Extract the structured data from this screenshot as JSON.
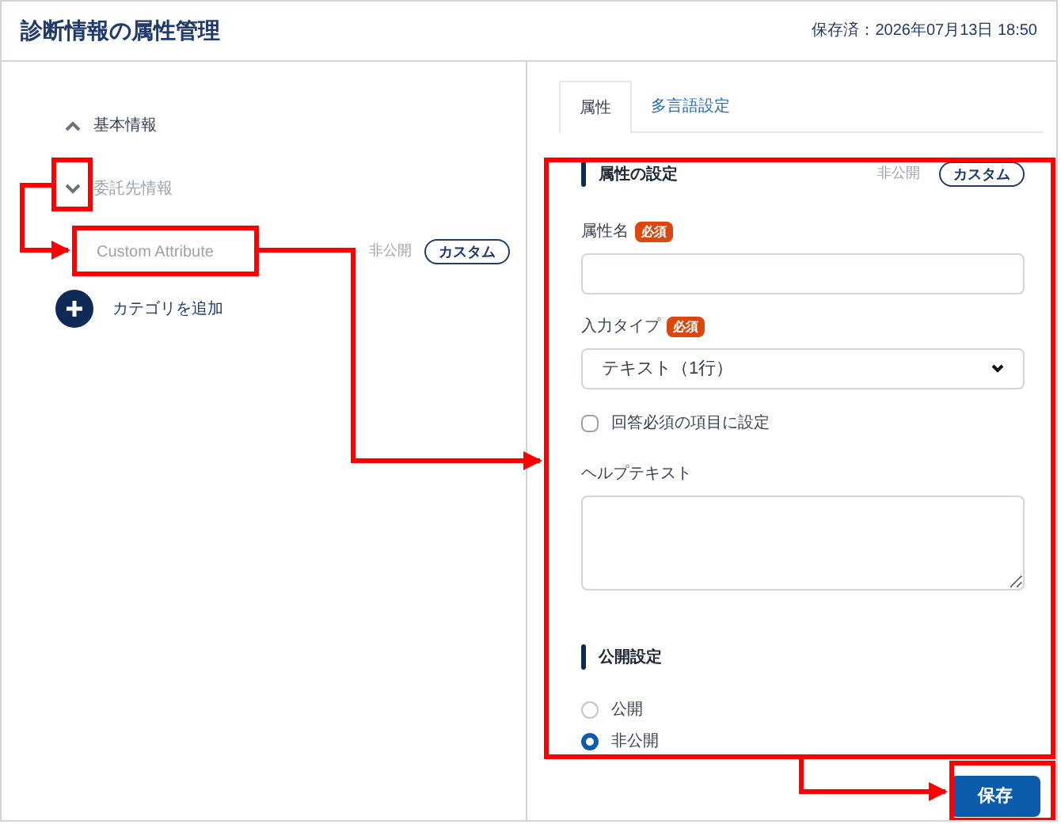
{
  "header": {
    "title": "診断情報の属性管理",
    "saved": "保存済：2026年07月13日 18:50"
  },
  "categories": [
    {
      "label": "基本情報",
      "expanded": false,
      "muted": false
    },
    {
      "label": "委託先情報",
      "expanded": true,
      "muted": true,
      "children": [
        {
          "label": "Custom Attribute",
          "status": "非公開",
          "badge": "カスタム",
          "muted": true
        }
      ]
    }
  ],
  "add_category": "カテゴリを追加",
  "tabs": [
    {
      "label": "属性",
      "selected": true
    },
    {
      "label": "多言語設定",
      "selected": false
    }
  ],
  "attribute_section": {
    "title": "属性の設定",
    "status": "非公開",
    "badge": "カスタム"
  },
  "fields": [
    {
      "kind": "text",
      "label": "属性名",
      "required": "必須"
    },
    {
      "kind": "select",
      "label": "入力タイプ",
      "required": "必須",
      "value": "テキスト（1行）"
    },
    {
      "kind": "checkbox",
      "label": "回答必須の項目に設定",
      "checked": false
    },
    {
      "kind": "textarea",
      "label": "ヘルプテキスト"
    }
  ],
  "visibility_section": {
    "title": "公開設定",
    "options": [
      {
        "label": "公開",
        "selected": false
      },
      {
        "label": "非公開",
        "selected": true
      }
    ]
  },
  "save_button": "保存"
}
